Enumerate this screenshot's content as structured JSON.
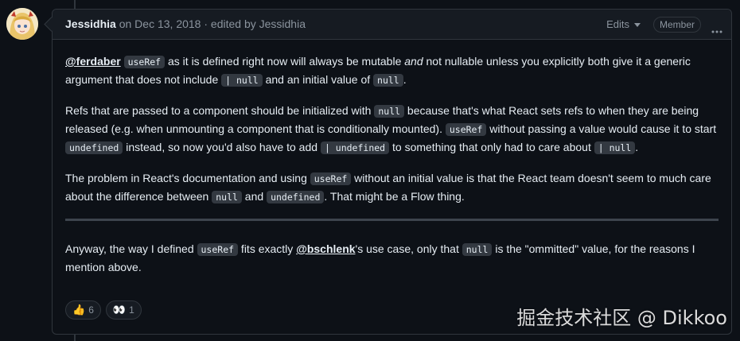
{
  "comment": {
    "author": "Jessidhia",
    "meta": " on Dec 13, 2018 · edited by Jessidhia",
    "edits_label": "Edits",
    "badge": "Member",
    "paragraphs": {
      "p1": {
        "mention": "@ferdaber",
        "code1": "useRef",
        "t1": " as it is defined right now will always be mutable ",
        "em": "and",
        "t2": " not nullable unless you explicitly both give it a generic argument that does not include ",
        "code2": "| null",
        "t3": " and an initial value of ",
        "code3": "null",
        "t4": "."
      },
      "p2": {
        "t1": "Refs that are passed to a component should be initialized with ",
        "code1": "null",
        "t2": " because that's what React sets refs to when they are being released (e.g. when unmounting a component that is conditionally mounted). ",
        "code2": "useRef",
        "t3": " without passing a value would cause it to start ",
        "code3": "undefined",
        "t4": " instead, so now you'd also have to add ",
        "code4": "| undefined",
        "t5": " to something that only had to care about ",
        "code5": "| null",
        "t6": "."
      },
      "p3": {
        "t1": "The problem in React's documentation and using ",
        "code1": "useRef",
        "t2": " without an initial value is that the React team doesn't seem to much care about the difference between ",
        "code2": "null",
        "t3": " and ",
        "code3": "undefined",
        "t4": ". That might be a Flow thing."
      },
      "p4": {
        "t1": "Anyway, the way I defined ",
        "code1": "useRef",
        "t2": " fits exactly ",
        "mention": "@bschlenk",
        "t3": "'s use case, only that ",
        "code2": "null",
        "t4": " is the \"ommitted\" value, for the reasons I mention above."
      }
    },
    "reactions": [
      {
        "emoji": "👍",
        "icon": "thumbs-up-icon",
        "count": "6"
      },
      {
        "emoji": "👀",
        "icon": "eyes-icon",
        "count": "1"
      }
    ]
  },
  "watermark": "掘金技术社区 @ Dikkoo",
  "colors": {
    "background": "#0d1117",
    "header": "#161b22",
    "border": "#30363d",
    "muted": "#8b949e",
    "text": "#e6edf3"
  }
}
